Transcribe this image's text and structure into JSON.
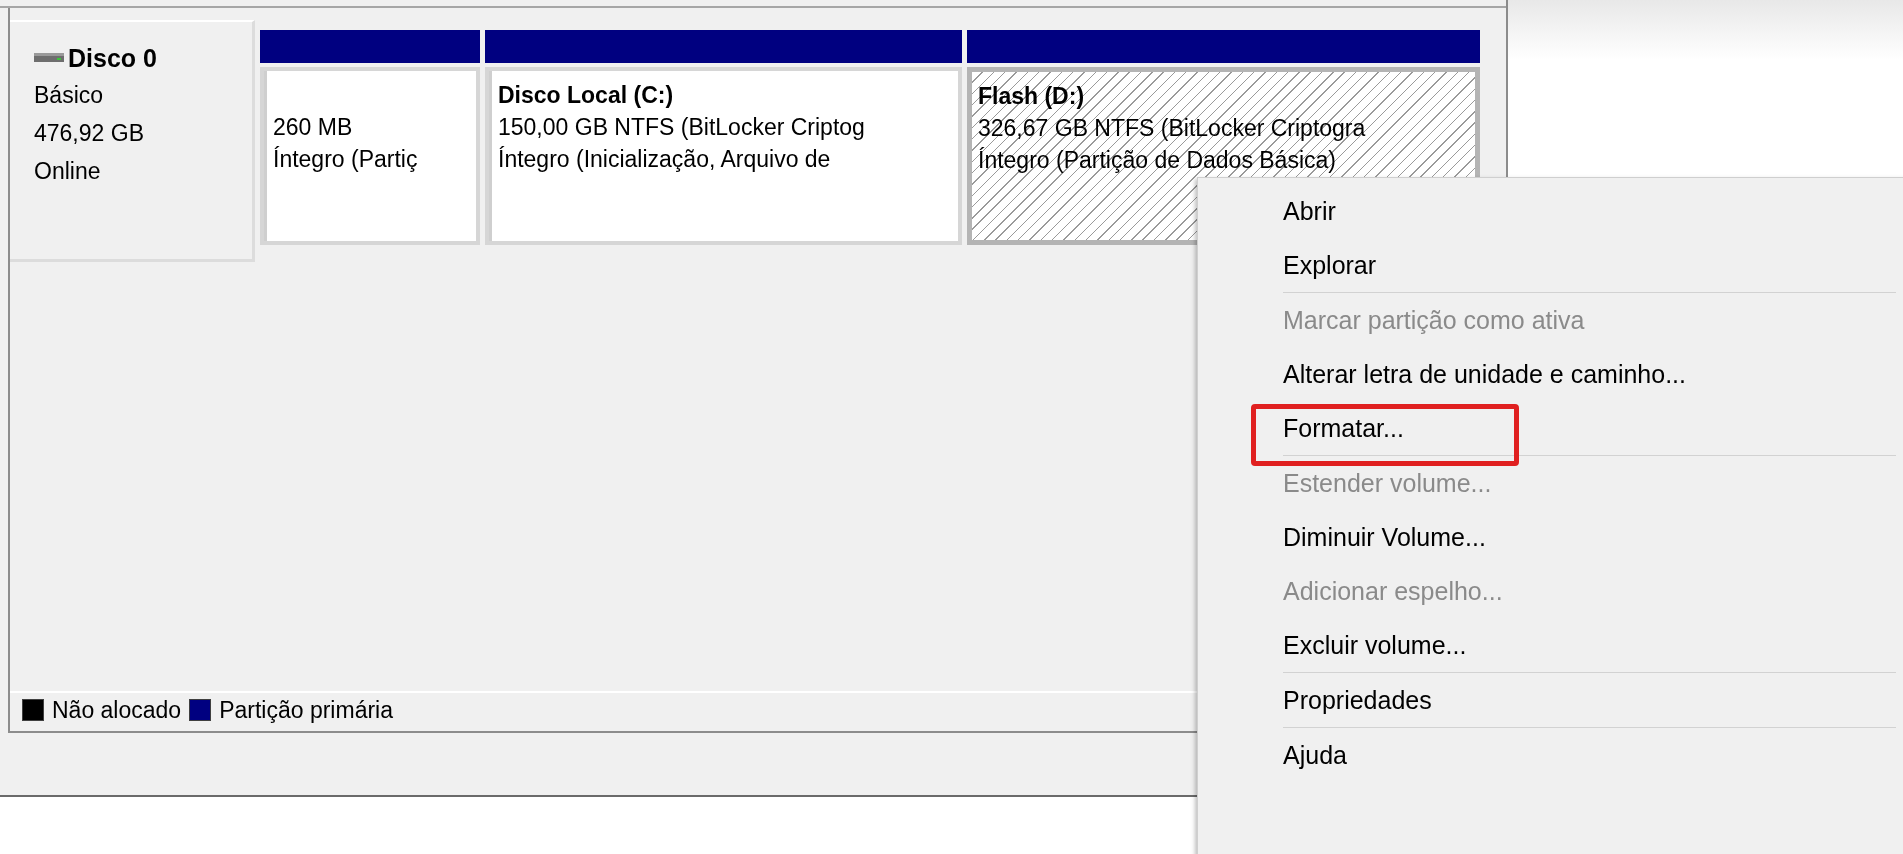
{
  "disk": {
    "name": "Disco 0",
    "type": "Básico",
    "size": "476,92 GB",
    "status": "Online"
  },
  "partitions": [
    {
      "kind": "primary",
      "selected": false,
      "lines": [
        "260 MB",
        "Íntegro (Partiç"
      ]
    },
    {
      "kind": "primary",
      "selected": false,
      "title": "Disco Local  (C:)",
      "lines": [
        "150,00 GB NTFS (BitLocker Criptog",
        "Íntegro (Inicialização, Arquivo de"
      ]
    },
    {
      "kind": "primary",
      "selected": true,
      "title": "Flash  (D:)",
      "lines": [
        "326,67 GB NTFS (BitLocker Criptogra",
        "Íntegro (Partição de Dados Básica)"
      ]
    }
  ],
  "legend": [
    {
      "label": "Não alocado",
      "color": "#000000"
    },
    {
      "label": "Partição primária",
      "color": "#000080"
    }
  ],
  "context_menu": [
    {
      "kind": "command",
      "label": "Abrir",
      "disabled": false,
      "highlighted": false
    },
    {
      "kind": "command",
      "label": "Explorar",
      "disabled": false,
      "highlighted": false
    },
    {
      "kind": "separator"
    },
    {
      "kind": "command",
      "label": "Marcar partição como ativa",
      "disabled": true,
      "highlighted": false
    },
    {
      "kind": "command",
      "label": "Alterar letra de unidade e caminho...",
      "disabled": false,
      "highlighted": false
    },
    {
      "kind": "command",
      "label": "Formatar...",
      "disabled": false,
      "highlighted": true
    },
    {
      "kind": "separator"
    },
    {
      "kind": "command",
      "label": "Estender volume...",
      "disabled": true,
      "highlighted": false
    },
    {
      "kind": "command",
      "label": "Diminuir Volume...",
      "disabled": false,
      "highlighted": false
    },
    {
      "kind": "command",
      "label": "Adicionar espelho...",
      "disabled": true,
      "highlighted": false
    },
    {
      "kind": "command",
      "label": "Excluir volume...",
      "disabled": false,
      "highlighted": false
    },
    {
      "kind": "separator"
    },
    {
      "kind": "command",
      "label": "Propriedades",
      "disabled": false,
      "highlighted": false
    },
    {
      "kind": "separator"
    },
    {
      "kind": "command",
      "label": "Ajuda",
      "disabled": false,
      "highlighted": false
    }
  ]
}
